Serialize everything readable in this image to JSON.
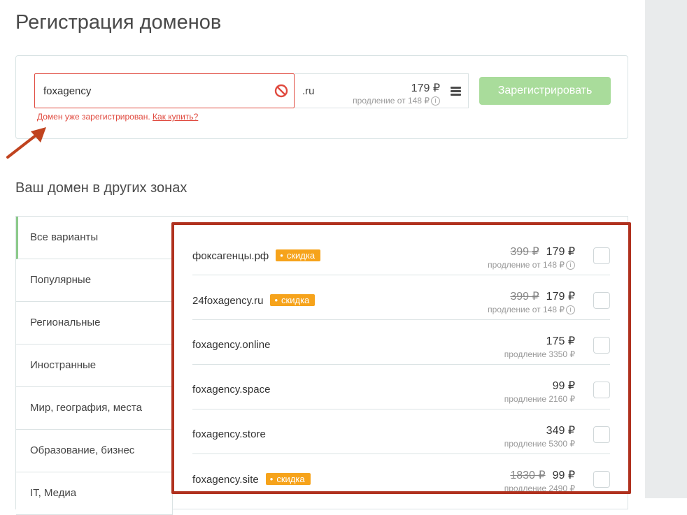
{
  "page": {
    "title": "Регистрация доменов"
  },
  "search": {
    "value": "foxagency",
    "zone": ".ru",
    "price": "179 ₽",
    "renewal": "продление от 148 ₽",
    "register_label": "Зарегистрировать",
    "error_text": "Домен уже зарегистрирован.",
    "error_link": "Как купить?"
  },
  "other_zones": {
    "title": "Ваш домен в других зонах",
    "categories": [
      {
        "label": "Все варианты",
        "active": true
      },
      {
        "label": "Популярные"
      },
      {
        "label": "Региональные"
      },
      {
        "label": "Иностранные"
      },
      {
        "label": "Мир, география, места"
      },
      {
        "label": "Образование, бизнес"
      },
      {
        "label": "IT, Медиа"
      }
    ],
    "results": [
      {
        "domain": "фоксагенцы.рф",
        "badge": "скидка",
        "old_price": "399 ₽",
        "price": "179 ₽",
        "renewal": "продление от 148 ₽"
      },
      {
        "domain": "24foxagency.ru",
        "badge": "скидка",
        "old_price": "399 ₽",
        "price": "179 ₽",
        "renewal": "продление от 148 ₽"
      },
      {
        "domain": "foxagency.online",
        "price": "175 ₽",
        "renewal": "продление 3350 ₽"
      },
      {
        "domain": "foxagency.space",
        "price": "99 ₽",
        "renewal": "продление 2160 ₽"
      },
      {
        "domain": "foxagency.store",
        "price": "349 ₽",
        "renewal": "продление 5300 ₽"
      },
      {
        "domain": "foxagency.site",
        "badge": "скидка",
        "old_price": "1830 ₽",
        "price": "99 ₽",
        "renewal": "продление 2490 ₽"
      }
    ]
  },
  "colors": {
    "error": "#e04a3f",
    "accent_green": "#a9dc9b",
    "badge": "#f6a31b",
    "highlight_border": "#b0311e"
  }
}
